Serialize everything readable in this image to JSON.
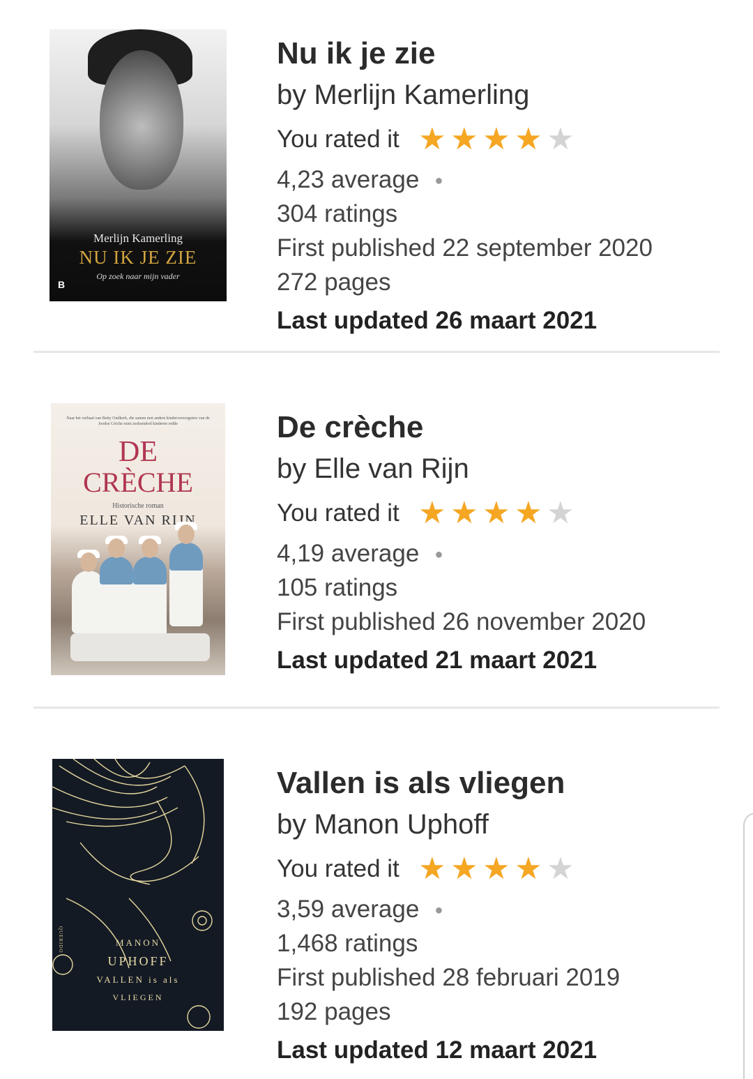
{
  "colors": {
    "star_on": "#f5a623",
    "star_off": "#d4d4d4",
    "divider": "#e6e6e6",
    "title": "#2b2b2b"
  },
  "books": [
    {
      "title": "Nu ik je zie",
      "author": "by Merlijn Kamerling",
      "rated_label": "You rated it",
      "user_rating": 4,
      "max_rating": 5,
      "average": "4,23 average",
      "ratings": "304 ratings",
      "first_published": "First published 22 september 2020",
      "pages": "272 pages",
      "last_updated": "Last updated 26 maart 2021",
      "cover": {
        "author": "Merlijn Kamerling",
        "title": "NU IK JE ZIE",
        "subtitle": "Op zoek naar mijn vader",
        "publisher_mark": "B"
      }
    },
    {
      "title": "De crèche",
      "author": "by Elle van Rijn",
      "rated_label": "You rated it",
      "user_rating": 4,
      "max_rating": 5,
      "average": "4,19 average",
      "ratings": "105 ratings",
      "first_published": "First published 26 november 2020",
      "last_updated": "Last updated 21 maart 2021",
      "cover": {
        "tagline": "Naar het verhaal van Betty Oudkerk, die samen met andere kinderverzorgsters van de Joodse Crèche ruim zeshonderd kinderen redde",
        "title_line1": "DE",
        "title_line2": "CRÈCHE",
        "genre": "Historische roman",
        "author": "ELLE VAN RIJN"
      }
    },
    {
      "title": "Vallen is als vliegen",
      "author": "by Manon Uphoff",
      "rated_label": "You rated it",
      "user_rating": 4,
      "max_rating": 5,
      "average": "3,59 average",
      "ratings": "1,468 ratings",
      "first_published": "First published 28 februari 2019",
      "pages": "192 pages",
      "last_updated": "Last updated 12 maart 2021",
      "cover": {
        "author_first": "MANON",
        "author_last": "UPHOFF",
        "title_a": "VALLEN is als",
        "title_b": "VLIEGEN",
        "publisher": "QUERIDO"
      }
    }
  ]
}
